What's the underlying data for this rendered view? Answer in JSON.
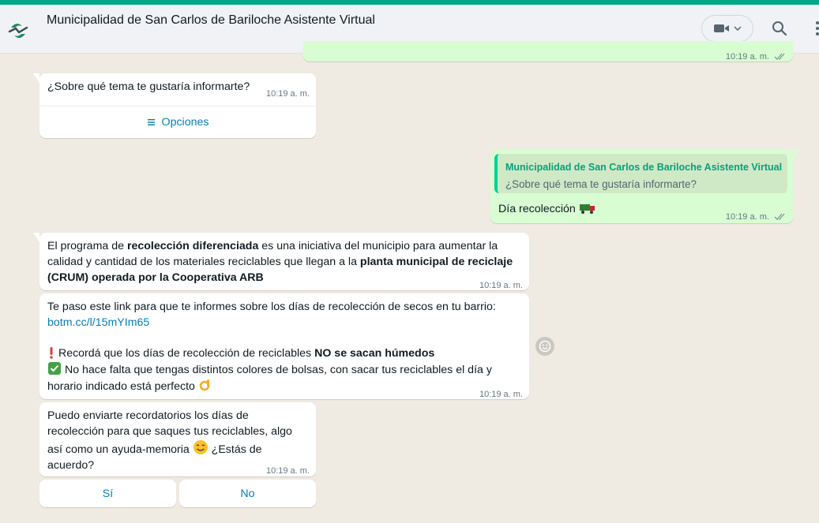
{
  "header": {
    "title": "Municipalidad de San Carlos de Bariloche Asistente Virtual"
  },
  "colors": {
    "accent": "#00a884",
    "incoming_bubble": "#ffffff",
    "outgoing_bubble": "#d9fdd3",
    "link": "#027eb5",
    "chat_background": "#efeae2"
  },
  "icons": {
    "avatar": "bariloche-logo-icon",
    "video": "video-camera-icon",
    "search": "search-icon",
    "menu": "kebab-menu-icon",
    "list": "list-icon",
    "ticks": "double-check-icon",
    "react": "emoji-smile-icon"
  },
  "messages": {
    "prev_out": {
      "time": "10:19 a. m."
    },
    "question": {
      "text": "¿Sobre qué tema te gustaría informarte?",
      "time": "10:19 a. m.",
      "options_label": "Opciones"
    },
    "reply": {
      "quoted_author": "Municipalidad de San Carlos de Bariloche Asistente Virtual",
      "quoted_text": "¿Sobre qué tema te gustaría informarte?",
      "text": "Día recolección",
      "time": "10:19 a. m."
    },
    "program": {
      "t1": "El programa de ",
      "b1": "recolección diferenciada",
      "t2": " es una iniciativa del municipio para aumentar la calidad y cantidad de los materiales reciclables que llegan a la ",
      "b2": "planta municipal de reciclaje (CRUM) operada por la Cooperativa ARB",
      "time": "10:19 a. m."
    },
    "link_msg": {
      "text": "Te paso este link para que te informes sobre los días de recolección de secos en tu barrio:",
      "link": "botm.cc/l/15mYIm65",
      "warn_text": " Recordá que los días de recolección de reciclables ",
      "warn_bold": "NO se sacan húmedos",
      "check_text": " No hace falta que tengas distintos colores de bolsas, con sacar tus reciclables el día y horario indicado está perfecto ",
      "time": "10:19 a. m."
    },
    "reminder": {
      "text1": "Puedo enviarte recordatorios los días de recolección para que saques tus reciclables, algo así como un ayuda-memoria ",
      "text2": " ¿Estás de acuerdo?",
      "time": "10:19 a. m.",
      "yes_label": "Sí",
      "no_label": "No"
    }
  }
}
